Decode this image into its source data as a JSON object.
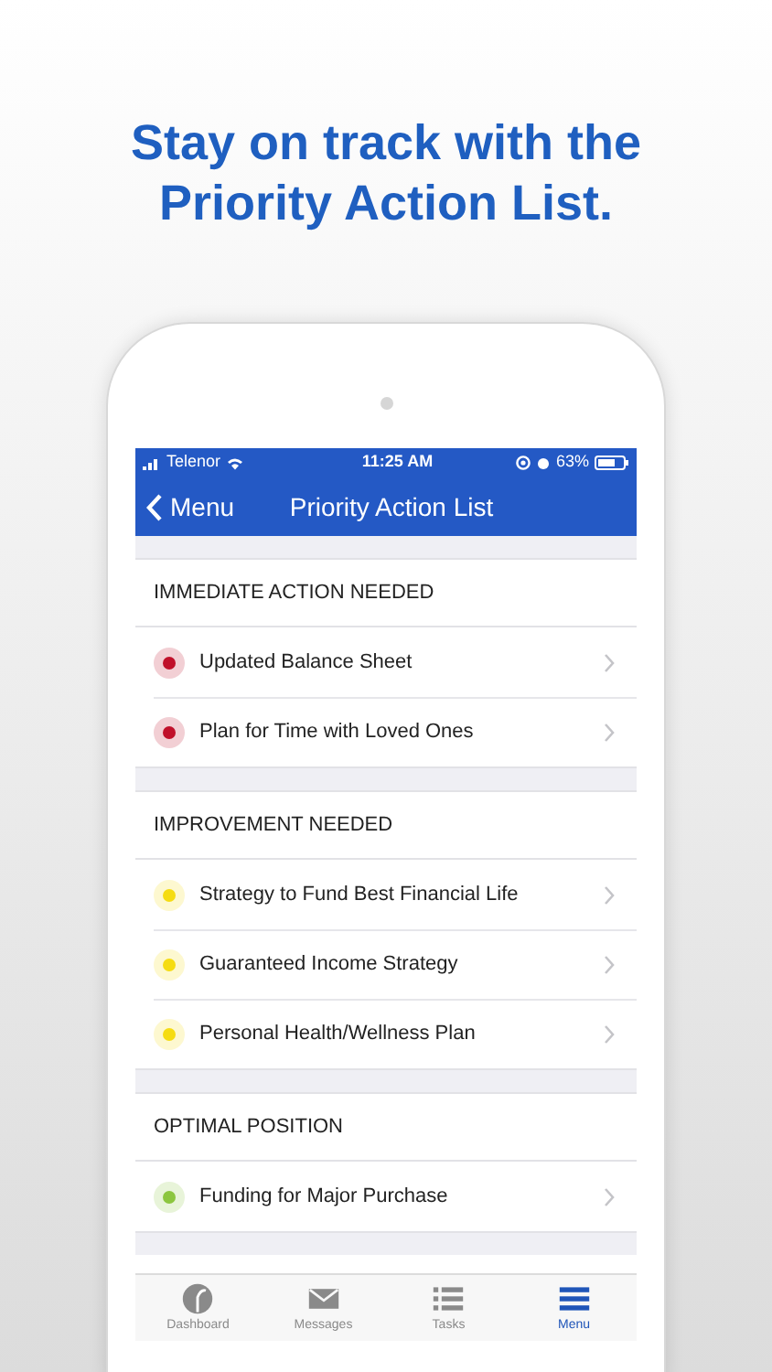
{
  "headline": "Stay on track with the Priority Action List.",
  "status_bar": {
    "carrier": "Telenor",
    "time": "11:25 AM",
    "battery": "63%"
  },
  "nav": {
    "back": "Menu",
    "title": "Priority Action List"
  },
  "sections": [
    {
      "title": "IMMEDIATE ACTION NEEDED",
      "items": [
        {
          "label": "Updated Balance Sheet",
          "color": "#c0102a"
        },
        {
          "label": "Plan for Time with Loved Ones",
          "color": "#c0102a"
        }
      ]
    },
    {
      "title": "IMPROVEMENT NEEDED",
      "items": [
        {
          "label": "Strategy to Fund Best Financial Life",
          "color": "#f5dc12"
        },
        {
          "label": "Guaranteed Income Strategy",
          "color": "#f5dc12"
        },
        {
          "label": "Personal Health/Wellness Plan",
          "color": "#f5dc12"
        }
      ]
    },
    {
      "title": "OPTIMAL POSITION",
      "items": [
        {
          "label": "Funding for Major Purchase",
          "color": "#8cc63f"
        }
      ]
    }
  ],
  "tabs": [
    {
      "kind": "gauge",
      "label": "Dashboard",
      "selected": false
    },
    {
      "kind": "envelope",
      "label": "Messages",
      "selected": false
    },
    {
      "kind": "list",
      "label": "Tasks",
      "selected": false
    },
    {
      "kind": "menu",
      "label": "Menu",
      "selected": true
    }
  ]
}
